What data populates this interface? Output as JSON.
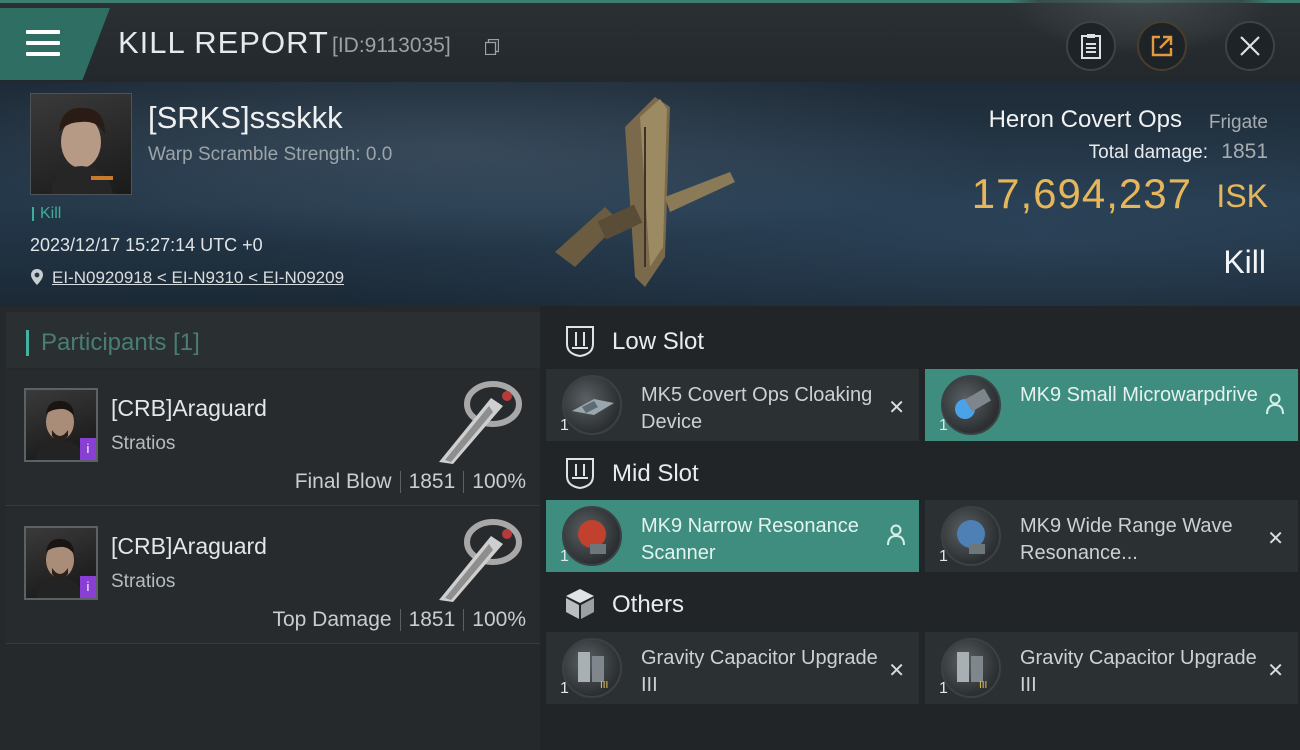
{
  "header": {
    "title": "KILL REPORT",
    "report_id": "[ID:9113035]",
    "icons": [
      "menu-icon",
      "copy-icon",
      "clipboard-icon",
      "share-icon",
      "close-icon"
    ]
  },
  "victim": {
    "name": "[SRKS]ssskkk",
    "warp_scramble": "Warp Scramble Strength: 0.0",
    "tag": "Kill",
    "datetime": "2023/12/17 15:27:14 UTC +0",
    "location": "EI-N0920918 < EI-N9310 < EI-N09209"
  },
  "ship": {
    "name": "Heron Covert Ops",
    "class": "Frigate",
    "damage_label": "Total damage:",
    "damage_value": "1851",
    "isk_value": "17,694,237",
    "isk_unit": "ISK",
    "outcome": "Kill"
  },
  "participants": {
    "title": "Participants [1]",
    "rows": [
      {
        "name": "[CRB]Araguard",
        "ship": "Stratios",
        "label": "Final Blow",
        "damage": "1851",
        "percent": "100%"
      },
      {
        "name": "[CRB]Araguard",
        "ship": "Stratios",
        "label": "Top Damage",
        "damage": "1851",
        "percent": "100%"
      }
    ]
  },
  "slots": {
    "low": {
      "label": "Low Slot",
      "items": [
        {
          "name": "MK5 Covert Ops Cloaking Device",
          "qty": "1",
          "state": "destroyed"
        },
        {
          "name": "MK9 Small Microwarpdrive",
          "qty": "1",
          "state": "dropped"
        }
      ]
    },
    "mid": {
      "label": "Mid Slot",
      "items": [
        {
          "name": "MK9 Narrow Resonance Scanner",
          "qty": "1",
          "state": "dropped"
        },
        {
          "name": "MK9 Wide Range Wave Resonance...",
          "qty": "1",
          "state": "destroyed"
        }
      ]
    },
    "others": {
      "label": "Others",
      "items": [
        {
          "name": "Gravity Capacitor Upgrade III",
          "qty": "1",
          "state": "destroyed"
        },
        {
          "name": "Gravity Capacitor Upgrade III",
          "qty": "1",
          "state": "destroyed"
        }
      ]
    },
    "destroyed_mark": "✕"
  },
  "colors": {
    "accent": "#3f8d7f",
    "isk": "#e6b75a",
    "badge": "#8a3fd4"
  }
}
